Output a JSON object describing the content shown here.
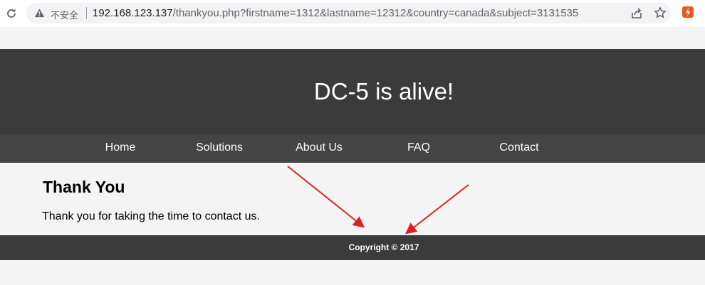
{
  "browser": {
    "security_label": "不安全",
    "url_host": "192.168.123.137",
    "url_rest": "/thankyou.php?firstname=1312&lastname=12312&country=canada&subject=3131535"
  },
  "header": {
    "title": "DC-5 is alive!"
  },
  "nav": {
    "items": [
      {
        "label": "Home"
      },
      {
        "label": "Solutions"
      },
      {
        "label": "About Us"
      },
      {
        "label": "FAQ"
      },
      {
        "label": "Contact"
      }
    ]
  },
  "content": {
    "heading": "Thank You",
    "message": "Thank you for taking the time to contact us."
  },
  "footer": {
    "copyright": "Copyright © 2017"
  },
  "colors": {
    "header_bg": "#3b3b3b",
    "nav_bg": "#444444",
    "page_bg": "#f4f4f4",
    "annotation_arrow": "#e02020"
  }
}
